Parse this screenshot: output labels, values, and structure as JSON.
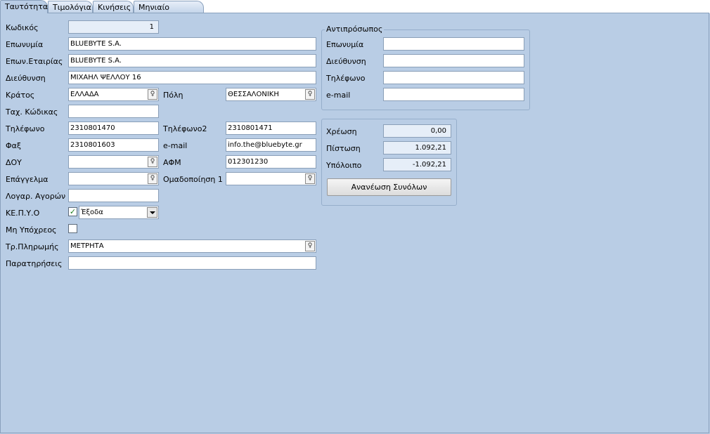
{
  "tabs": [
    "Ταυτότητα",
    "Τιμολόγια",
    "Κινήσεις",
    "Μηνιαίο Ισοζύγιο"
  ],
  "labels": {
    "code": "Κωδικός",
    "name": "Επωνυμία",
    "company_name": "Επων.Εταιρίας",
    "address": "Διεύθυνση",
    "country": "Κράτος",
    "city": "Πόλη",
    "postal_code": "Ταχ. Κώδικας",
    "phone": "Τηλέφωνο",
    "phone2": "Τηλέφωνο2",
    "fax": "Φαξ",
    "email": "e-mail",
    "tax_office": "ΔΟΥ",
    "vat": "ΑΦΜ",
    "profession": "Επάγγελμα",
    "group1": "Ομαδοποίηση 1",
    "purchase_account": "Λογαρ. Αγορών",
    "kepyo": "ΚΕ.Π.Υ.Ο",
    "not_obliged": "Μη Υπόχρεος",
    "payment_method": "Τρ.Πληρωμής",
    "notes": "Παρατηρήσεις"
  },
  "values": {
    "code": "1",
    "name": "BLUEBYTE S.A.",
    "company_name": "BLUEBYTE S.A.",
    "address": "ΜΙΧΑΗΛ ΨΕΛΛΟΥ 16",
    "country": "ΕΛΛΑΔΑ",
    "city": "ΘΕΣΣΑΛΟΝΙΚΗ",
    "postal_code": "",
    "phone": "2310801470",
    "phone2": "2310801471",
    "fax": "2310801603",
    "email": "info.the@bluebyte.gr",
    "tax_office": "",
    "vat": "012301230",
    "profession": "",
    "group1": "",
    "purchase_account": "",
    "kepyo_type": "Έξοδα",
    "payment_method": "ΜΕΤΡΗΤΑ",
    "notes": ""
  },
  "representative": {
    "title": "Αντιπρόσωπος",
    "name_label": "Επωνυμία",
    "address_label": "Διεύθυνση",
    "phone_label": "Τηλέφωνο",
    "email_label": "e-mail",
    "name": "",
    "address": "",
    "phone": "",
    "email": ""
  },
  "totals": {
    "debit_label": "Χρέωση",
    "credit_label": "Πίστωση",
    "balance_label": "Υπόλοιπο",
    "debit": "0,00",
    "credit": "1.092,21",
    "balance": "-1.092,21",
    "refresh_button": "Ανανέωση Συνόλων"
  },
  "icons": {
    "lookup": "lightbulb-icon",
    "dropdown": "chevron-down-icon",
    "check": "checkmark-icon"
  }
}
